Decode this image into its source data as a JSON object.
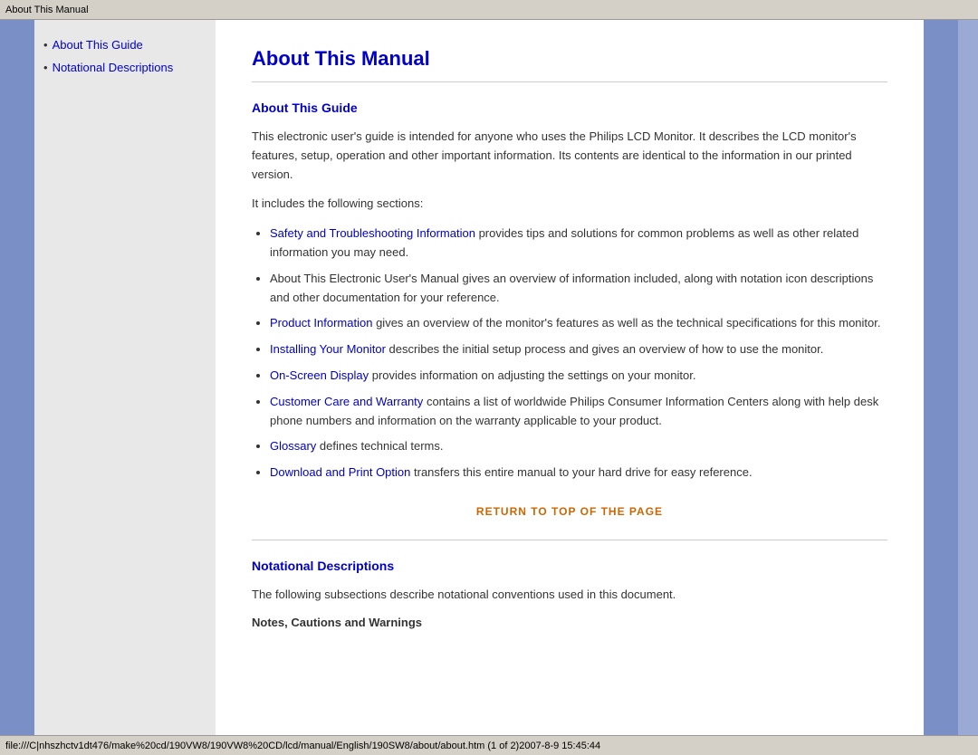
{
  "titlebar": {
    "text": "About This Manual"
  },
  "sidebar": {
    "items": [
      {
        "label": "About This Guide",
        "href": "#about-guide"
      },
      {
        "label": "Notational Descriptions",
        "href": "#notational"
      }
    ]
  },
  "content": {
    "page_title": "About This Manual",
    "sections": [
      {
        "id": "about-guide",
        "title": "About This Guide",
        "paragraphs": [
          "This electronic user's guide is intended for anyone who uses the Philips LCD Monitor. It describes the LCD monitor's features, setup, operation and other important information. Its contents are identical to the information in our printed version.",
          "It includes the following sections:"
        ],
        "list_items": [
          {
            "link_text": "Safety and Troubleshooting Information",
            "rest": " provides tips and solutions for common problems as well as other related information you may need."
          },
          {
            "link_text": null,
            "rest": "About This Electronic User's Manual gives an overview of information included, along with notation icon descriptions and other documentation for your reference."
          },
          {
            "link_text": "Product Information",
            "rest": " gives an overview of the monitor's features as well as the technical specifications for this monitor."
          },
          {
            "link_text": "Installing Your Monitor",
            "rest": " describes the initial setup process and gives an overview of how to use the monitor."
          },
          {
            "link_text": "On-Screen Display",
            "rest": " provides information on adjusting the settings on your monitor."
          },
          {
            "link_text": "Customer Care and Warranty",
            "rest": " contains a list of worldwide Philips Consumer Information Centers along with help desk phone numbers and information on the warranty applicable to your product."
          },
          {
            "link_text": "Glossary",
            "rest": " defines technical terms."
          },
          {
            "link_text": "Download and Print Option",
            "rest": " transfers this entire manual to your hard drive for easy reference."
          }
        ],
        "return_link": "RETURN TO TOP OF THE PAGE"
      }
    ],
    "notational_section": {
      "id": "notational",
      "title": "Notational Descriptions",
      "paragraph": "The following subsections describe notational conventions used in this document.",
      "bold_heading": "Notes, Cautions and Warnings"
    }
  },
  "statusbar": {
    "text": "file:///C|nhszhctv1dt476/make%20cd/190VW8/190VW8%20CD/lcd/manual/English/190SW8/about/about.htm (1 of 2)2007-8-9 15:45:44"
  }
}
